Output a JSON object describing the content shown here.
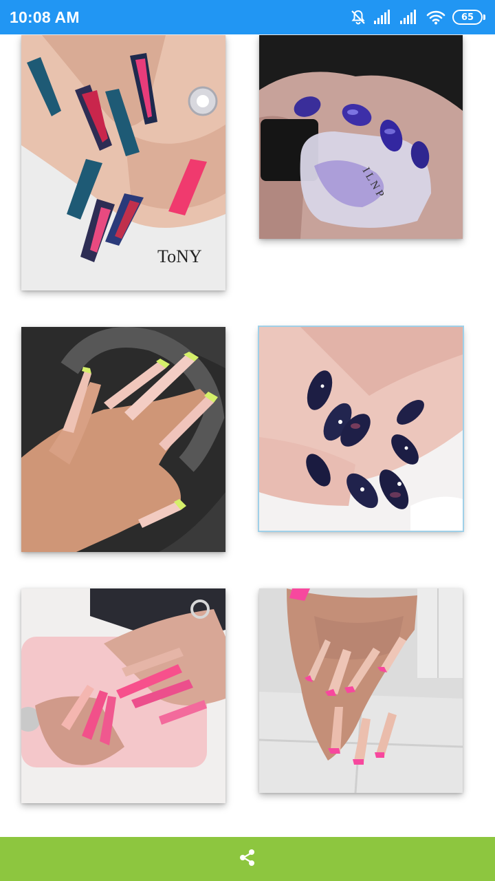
{
  "status_bar": {
    "time": "10:08 AM",
    "battery_level": "65",
    "icons": [
      "notifications-off-icon",
      "signal-icon",
      "signal-icon",
      "wifi-icon",
      "battery-icon"
    ],
    "background_color": "#2196f3"
  },
  "gallery": {
    "items": [
      {
        "name": "nail-image-1",
        "watermark": "ToNY"
      },
      {
        "name": "nail-image-2",
        "bottle_label": "I L N P"
      },
      {
        "name": "nail-image-3"
      },
      {
        "name": "nail-image-4"
      },
      {
        "name": "nail-image-5"
      },
      {
        "name": "nail-image-6"
      }
    ]
  },
  "bottom_bar": {
    "icon": "share-icon",
    "background_color": "#8dc63f"
  }
}
